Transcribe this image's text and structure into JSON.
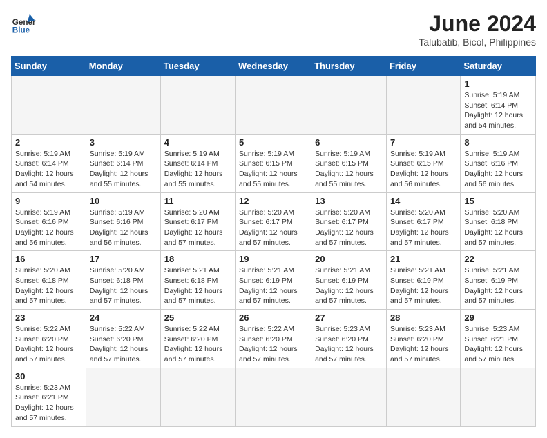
{
  "header": {
    "logo_general": "General",
    "logo_blue": "Blue",
    "month_title": "June 2024",
    "location": "Talubatib, Bicol, Philippines"
  },
  "days_of_week": [
    "Sunday",
    "Monday",
    "Tuesday",
    "Wednesday",
    "Thursday",
    "Friday",
    "Saturday"
  ],
  "weeks": [
    [
      {
        "day": "",
        "info": ""
      },
      {
        "day": "",
        "info": ""
      },
      {
        "day": "",
        "info": ""
      },
      {
        "day": "",
        "info": ""
      },
      {
        "day": "",
        "info": ""
      },
      {
        "day": "",
        "info": ""
      },
      {
        "day": "1",
        "info": "Sunrise: 5:19 AM\nSunset: 6:14 PM\nDaylight: 12 hours and 54 minutes."
      }
    ],
    [
      {
        "day": "2",
        "info": "Sunrise: 5:19 AM\nSunset: 6:14 PM\nDaylight: 12 hours and 54 minutes."
      },
      {
        "day": "3",
        "info": "Sunrise: 5:19 AM\nSunset: 6:14 PM\nDaylight: 12 hours and 55 minutes."
      },
      {
        "day": "4",
        "info": "Sunrise: 5:19 AM\nSunset: 6:14 PM\nDaylight: 12 hours and 55 minutes."
      },
      {
        "day": "5",
        "info": "Sunrise: 5:19 AM\nSunset: 6:15 PM\nDaylight: 12 hours and 55 minutes."
      },
      {
        "day": "6",
        "info": "Sunrise: 5:19 AM\nSunset: 6:15 PM\nDaylight: 12 hours and 55 minutes."
      },
      {
        "day": "7",
        "info": "Sunrise: 5:19 AM\nSunset: 6:15 PM\nDaylight: 12 hours and 56 minutes."
      },
      {
        "day": "8",
        "info": "Sunrise: 5:19 AM\nSunset: 6:16 PM\nDaylight: 12 hours and 56 minutes."
      }
    ],
    [
      {
        "day": "9",
        "info": "Sunrise: 5:19 AM\nSunset: 6:16 PM\nDaylight: 12 hours and 56 minutes."
      },
      {
        "day": "10",
        "info": "Sunrise: 5:19 AM\nSunset: 6:16 PM\nDaylight: 12 hours and 56 minutes."
      },
      {
        "day": "11",
        "info": "Sunrise: 5:20 AM\nSunset: 6:17 PM\nDaylight: 12 hours and 57 minutes."
      },
      {
        "day": "12",
        "info": "Sunrise: 5:20 AM\nSunset: 6:17 PM\nDaylight: 12 hours and 57 minutes."
      },
      {
        "day": "13",
        "info": "Sunrise: 5:20 AM\nSunset: 6:17 PM\nDaylight: 12 hours and 57 minutes."
      },
      {
        "day": "14",
        "info": "Sunrise: 5:20 AM\nSunset: 6:17 PM\nDaylight: 12 hours and 57 minutes."
      },
      {
        "day": "15",
        "info": "Sunrise: 5:20 AM\nSunset: 6:18 PM\nDaylight: 12 hours and 57 minutes."
      }
    ],
    [
      {
        "day": "16",
        "info": "Sunrise: 5:20 AM\nSunset: 6:18 PM\nDaylight: 12 hours and 57 minutes."
      },
      {
        "day": "17",
        "info": "Sunrise: 5:20 AM\nSunset: 6:18 PM\nDaylight: 12 hours and 57 minutes."
      },
      {
        "day": "18",
        "info": "Sunrise: 5:21 AM\nSunset: 6:18 PM\nDaylight: 12 hours and 57 minutes."
      },
      {
        "day": "19",
        "info": "Sunrise: 5:21 AM\nSunset: 6:19 PM\nDaylight: 12 hours and 57 minutes."
      },
      {
        "day": "20",
        "info": "Sunrise: 5:21 AM\nSunset: 6:19 PM\nDaylight: 12 hours and 57 minutes."
      },
      {
        "day": "21",
        "info": "Sunrise: 5:21 AM\nSunset: 6:19 PM\nDaylight: 12 hours and 57 minutes."
      },
      {
        "day": "22",
        "info": "Sunrise: 5:21 AM\nSunset: 6:19 PM\nDaylight: 12 hours and 57 minutes."
      }
    ],
    [
      {
        "day": "23",
        "info": "Sunrise: 5:22 AM\nSunset: 6:20 PM\nDaylight: 12 hours and 57 minutes."
      },
      {
        "day": "24",
        "info": "Sunrise: 5:22 AM\nSunset: 6:20 PM\nDaylight: 12 hours and 57 minutes."
      },
      {
        "day": "25",
        "info": "Sunrise: 5:22 AM\nSunset: 6:20 PM\nDaylight: 12 hours and 57 minutes."
      },
      {
        "day": "26",
        "info": "Sunrise: 5:22 AM\nSunset: 6:20 PM\nDaylight: 12 hours and 57 minutes."
      },
      {
        "day": "27",
        "info": "Sunrise: 5:23 AM\nSunset: 6:20 PM\nDaylight: 12 hours and 57 minutes."
      },
      {
        "day": "28",
        "info": "Sunrise: 5:23 AM\nSunset: 6:20 PM\nDaylight: 12 hours and 57 minutes."
      },
      {
        "day": "29",
        "info": "Sunrise: 5:23 AM\nSunset: 6:21 PM\nDaylight: 12 hours and 57 minutes."
      }
    ],
    [
      {
        "day": "30",
        "info": "Sunrise: 5:23 AM\nSunset: 6:21 PM\nDaylight: 12 hours and 57 minutes."
      },
      {
        "day": "",
        "info": ""
      },
      {
        "day": "",
        "info": ""
      },
      {
        "day": "",
        "info": ""
      },
      {
        "day": "",
        "info": ""
      },
      {
        "day": "",
        "info": ""
      },
      {
        "day": "",
        "info": ""
      }
    ]
  ]
}
